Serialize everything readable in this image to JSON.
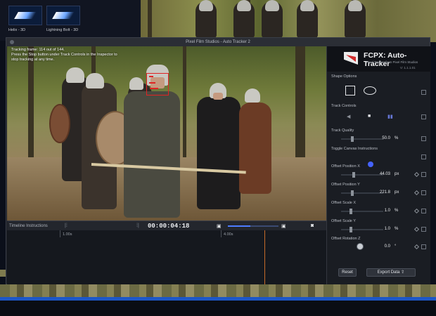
{
  "library": {
    "thumbs": [
      {
        "label": "Helix - 3D"
      },
      {
        "label": "Lightning Bolt - 3D"
      }
    ]
  },
  "window": {
    "title": "Pixel Film Studios - Auto Tracker 2"
  },
  "viewer": {
    "tracking_info_line1": "Tracking frame: 114 out of 144.",
    "tracking_info_line2": "Press the Stop button under Track Controls in the Inspector to",
    "tracking_info_line3": "stop tracking at any time."
  },
  "timeline": {
    "title": "Timeline Instructions",
    "timecode": "00:00:04:18",
    "ruler_labels": [
      "1.00s",
      "4.00s"
    ],
    "zoom_fraction": 0.45
  },
  "inspector": {
    "brand_title": "FCPX: Auto-Tracker",
    "brand_subtitle": "Pixel Tracker from Pixel Film Studios",
    "version": "V: 1.1.1.01",
    "shape_options_label": "Shape Options",
    "track_controls_label": "Track Controls",
    "track_quality": {
      "label": "Track Quality",
      "value": "50.0",
      "unit": "%"
    },
    "toggle_canvas_label": "Toggle Canvas Instructions",
    "offset_position_x": {
      "label": "Offset Position X",
      "value": "44.03",
      "unit": "px"
    },
    "offset_position_y": {
      "label": "Offset Position Y",
      "value": "221.8",
      "unit": "px"
    },
    "offset_scale_x": {
      "label": "Offset Scale X",
      "value": "1.0",
      "unit": "%"
    },
    "offset_scale_y": {
      "label": "Offset Scale Y",
      "value": "1.0",
      "unit": "%"
    },
    "offset_rotation_z": {
      "label": "Offset Rotation Z",
      "value": "0.0",
      "unit": "°"
    },
    "reset_label": "Reset",
    "export_label": "Export Data"
  },
  "colors": {
    "tracker": "#e02424",
    "accent": "#4563ff",
    "timeline_strip": "#1d57c7"
  }
}
